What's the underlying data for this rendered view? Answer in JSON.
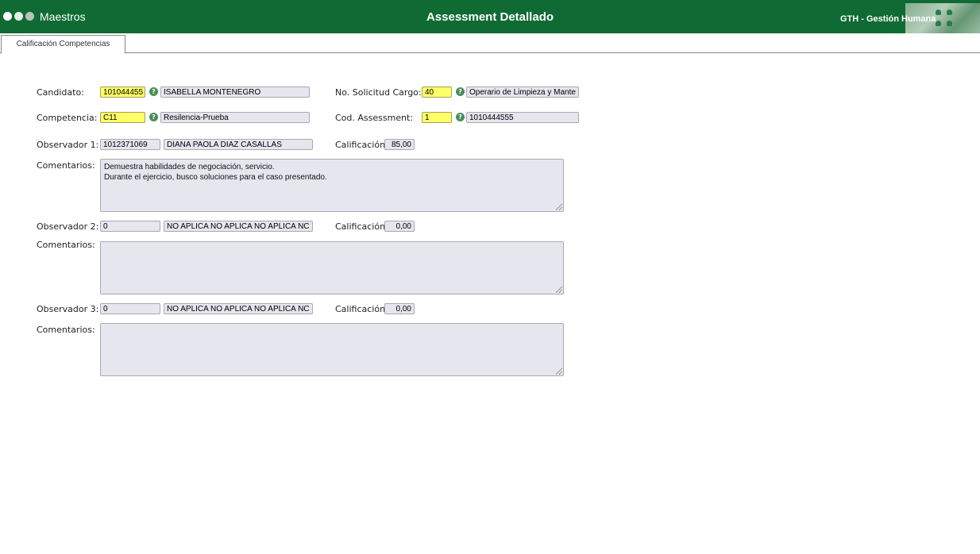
{
  "header": {
    "menu_label": "Maestros",
    "title": "Assessment Detallado",
    "org": "GTH - Gestión Humana",
    "bg_color": "#0f6b33"
  },
  "tabs": [
    {
      "label": "Calificación Competencias"
    }
  ],
  "form": {
    "candidato": {
      "label": "Candidato:",
      "code": "101044455",
      "name": "ISABELLA MONTENEGRO"
    },
    "solicitud": {
      "label": "No. Solicitud Cargo:",
      "code": "40",
      "name": "Operario de Limpieza y Mante"
    },
    "competencia": {
      "label": "Competencia:",
      "code": "C11",
      "name": "Resilencia-Prueba"
    },
    "assessment": {
      "label": "Cod. Assessment:",
      "code": "1",
      "name": "1010444555"
    },
    "obs1": {
      "label": "Observador 1:",
      "id": "1012371069",
      "name": "DIANA PAOLA DIAZ CASALLAS",
      "calif_label": "Calificación:",
      "calif": "85,00",
      "comments_label": "Comentarios:",
      "comments": "Demuestra habilidades de negociación, servicio.\nDurante el ejercicio, busco soluciones para el caso presentado."
    },
    "obs2": {
      "label": "Observador 2:",
      "id": "0",
      "name": "NO APLICA NO APLICA NO APLICA NC",
      "calif_label": "Calificación:",
      "calif": "0,00",
      "comments_label": "Comentarios:",
      "comments": ""
    },
    "obs3": {
      "label": "Observador 3:",
      "id": "0",
      "name": "NO APLICA NO APLICA NO APLICA NC",
      "calif_label": "Calificación:",
      "calif": "0,00",
      "comments_label": "Comentarios:",
      "comments": ""
    }
  },
  "icons": {
    "help": "help-icon"
  },
  "colors": {
    "required_field": "#ffff66",
    "readonly_field": "#e6e6ee"
  }
}
